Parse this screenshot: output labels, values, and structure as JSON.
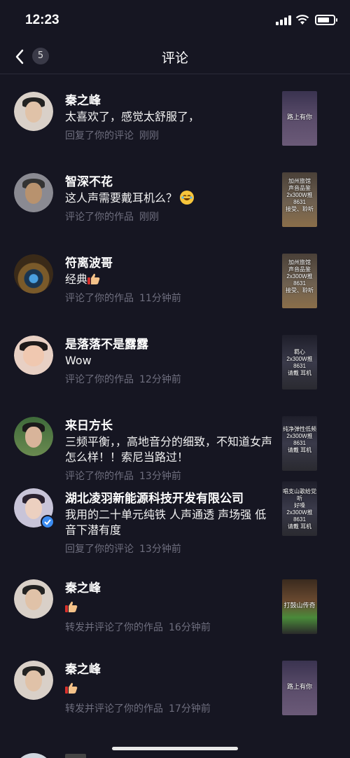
{
  "status_bar": {
    "time": "12:23",
    "battery_level": 0.75
  },
  "nav": {
    "title": "评论",
    "back_count": "5"
  },
  "comments": [
    {
      "name": "秦之峰",
      "content": "太喜欢了，感觉太舒服了，",
      "action": "回复了你的评论",
      "time": "刚刚",
      "thumb_text": "路上有你",
      "emoji": ""
    },
    {
      "name": "智深不花",
      "content": "这人声需要戴耳机么？",
      "action": "评论了你的作品",
      "time": "刚刚",
      "thumb_text": "加州旅馆\n声音品鉴\n2x300W推8631\n接受、聆听",
      "emoji": "laughing-emoji"
    },
    {
      "name": "符离波哥",
      "content": "经典",
      "action": "评论了你的作品",
      "time": "11分钟前",
      "thumb_text": "加州旅馆\n声音品鉴\n2x300W推8631\n接受、聆听",
      "emoji": "thumbs-up-emoji"
    },
    {
      "name": "是落落不是露露",
      "content": "Wow",
      "action": "评论了你的作品",
      "time": "12分钟前",
      "thumb_text": "羁心\n2x300W推8631\n请戴     耳机",
      "emoji": ""
    },
    {
      "name": "来日方长",
      "content": "三频平衡，，高地音分的细致，不知道女声怎么样！！索尼当路过！",
      "action": "评论了你的作品",
      "time": "13分钟前",
      "thumb_text": "纯净弹性低频\n2x300W推8631\n请戴     耳机",
      "emoji": ""
    },
    {
      "name": "湖北凌羽新能源科技开发有限公司",
      "content": "我用的二十单元纯铁 人声通透 声场强 低音下潜有度",
      "action": "回复了你的评论",
      "time": "13分钟前",
      "thumb_text": "唱支山歌给党听\n好嗓\n2x300W推8631\n请戴     耳机",
      "emoji": "",
      "verified": true
    },
    {
      "name": "秦之峰",
      "content": "",
      "action": "转发并评论了你的作品",
      "time": "16分钟前",
      "thumb_text": "打鼓山传奇",
      "emoji": "thumbs-up-emoji"
    },
    {
      "name": "秦之峰",
      "content": "",
      "action": "转发并评论了你的作品",
      "time": "17分钟前",
      "thumb_text": "路上有你",
      "emoji": "thumbs-up-emoji"
    }
  ]
}
